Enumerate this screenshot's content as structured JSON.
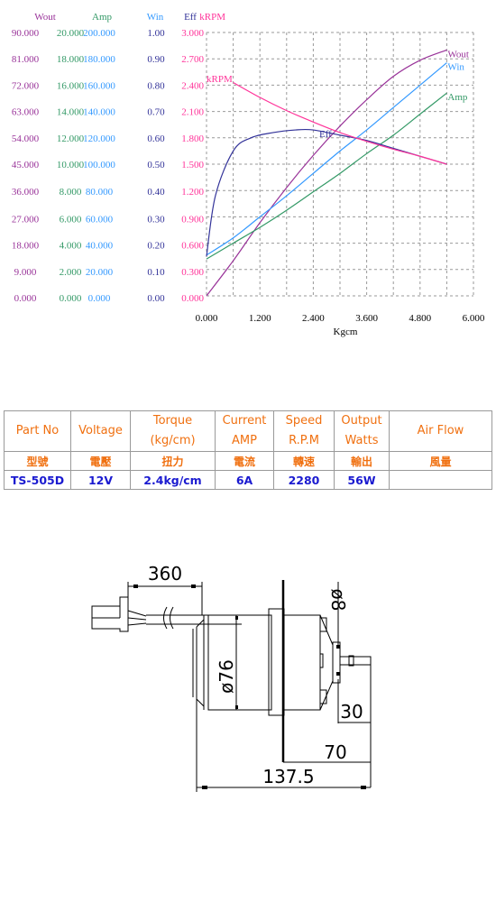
{
  "chart_data": {
    "type": "line",
    "title": "",
    "xlabel": "Kgcm",
    "xlim": [
      0,
      6
    ],
    "x_ticks": [
      "0.000",
      "1.200",
      "2.400",
      "3.600",
      "4.800",
      "6.000"
    ],
    "grid": true,
    "axes": [
      {
        "name": "Wout",
        "color": "#993399",
        "ylim": [
          0,
          90
        ],
        "ticks": [
          "90.000",
          "81.000",
          "72.000",
          "63.000",
          "54.000",
          "45.000",
          "36.000",
          "27.000",
          "18.000",
          "9.000",
          "0.000"
        ]
      },
      {
        "name": "Amp",
        "color": "#339966",
        "ylim": [
          0,
          20
        ],
        "ticks": [
          "20.000",
          "18.000",
          "16.000",
          "14.000",
          "12.000",
          "10.000",
          "8.000",
          "6.000",
          "4.000",
          "2.000",
          "0.000"
        ]
      },
      {
        "name": "Win",
        "color": "#3399ff",
        "ylim": [
          0,
          200
        ],
        "ticks": [
          "200.000",
          "180.000",
          "160.000",
          "140.000",
          "120.000",
          "100.000",
          "80.000",
          "60.000",
          "40.000",
          "20.000",
          "0.000"
        ]
      },
      {
        "name": "Eff",
        "color": "#333399",
        "ylim": [
          0,
          1
        ],
        "ticks": [
          "1.00",
          "0.90",
          "0.80",
          "0.70",
          "0.60",
          "0.50",
          "0.40",
          "0.30",
          "0.20",
          "0.10",
          "0.00"
        ]
      },
      {
        "name": "kRPM",
        "color": "#ff3399",
        "ylim": [
          0,
          3
        ],
        "ticks": [
          "3.000",
          "2.700",
          "2.400",
          "2.100",
          "1.800",
          "1.500",
          "1.200",
          "0.900",
          "0.600",
          "0.300",
          "0.000"
        ]
      }
    ],
    "series": [
      {
        "name": "Wout",
        "label": "Wout",
        "color": "#993399",
        "x": [
          0,
          0.6,
          1.2,
          1.8,
          2.4,
          3.0,
          3.6,
          4.2,
          4.8,
          5.4
        ],
        "y": [
          0,
          12,
          25,
          37,
          48,
          58,
          67,
          75,
          80.5,
          84
        ]
      },
      {
        "name": "Win",
        "label": "Win",
        "color": "#3399ff",
        "x": [
          0,
          0.6,
          1.2,
          1.8,
          2.4,
          3.0,
          3.6,
          4.2,
          4.8,
          5.4
        ],
        "y": [
          31,
          44,
          60,
          76,
          93,
          110,
          126,
          143,
          160,
          177
        ]
      },
      {
        "name": "Amp",
        "label": "Amp",
        "color": "#339966",
        "x": [
          0,
          0.6,
          1.2,
          1.8,
          2.4,
          3.0,
          3.6,
          4.2,
          4.8,
          5.4
        ],
        "y": [
          2.8,
          4.0,
          5.2,
          6.5,
          7.9,
          9.3,
          10.8,
          12.2,
          13.8,
          15.4
        ]
      },
      {
        "name": "Eff",
        "label": "Eff",
        "color": "#333399",
        "x": [
          0,
          0.2,
          0.6,
          1.0,
          1.5,
          2.0,
          2.4,
          3.0,
          3.6,
          4.2,
          4.8,
          5.4
        ],
        "y": [
          0.15,
          0.38,
          0.55,
          0.6,
          0.62,
          0.63,
          0.63,
          0.61,
          0.59,
          0.56,
          0.53,
          0.5
        ]
      },
      {
        "name": "kRPM",
        "label": "kRPM",
        "color": "#ff3399",
        "x": [
          0.6,
          1.2,
          1.8,
          2.4,
          3.0,
          3.6,
          4.2,
          4.8,
          5.4
        ],
        "y": [
          2.43,
          2.26,
          2.11,
          1.98,
          1.86,
          1.76,
          1.67,
          1.59,
          1.5
        ]
      }
    ],
    "series_labels_placement": "right end of each curve; kRPM label at left start, Eff label near peak"
  },
  "spec_table": {
    "headers": [
      "Part No",
      "Voltage",
      "Torque\n(kg/cm)",
      "Current\nAMP",
      "Speed\nR.P.M",
      "Output\nWatts",
      "Air  Flow"
    ],
    "header_lines": [
      [
        "Part No"
      ],
      [
        "Voltage"
      ],
      [
        "Torque",
        "(kg/cm)"
      ],
      [
        "Current",
        "AMP"
      ],
      [
        "Speed",
        "R.P.M"
      ],
      [
        "Output",
        "Watts"
      ],
      [
        "Air  Flow"
      ]
    ],
    "chinese_headers": [
      "型號",
      "電壓",
      "扭力",
      "電流",
      "轉速",
      "輸出",
      "風量"
    ],
    "rows": [
      [
        "TS-505D",
        "12V",
        "2.4kg/cm",
        "6A",
        "2280",
        "56W",
        ""
      ]
    ]
  },
  "drawing": {
    "dimensions": {
      "lead_length": "360",
      "shaft_diameter": "ø8",
      "body_diameter": "ø76",
      "shaft_length": "30",
      "front_length": "70",
      "total_length": "137.5"
    }
  }
}
